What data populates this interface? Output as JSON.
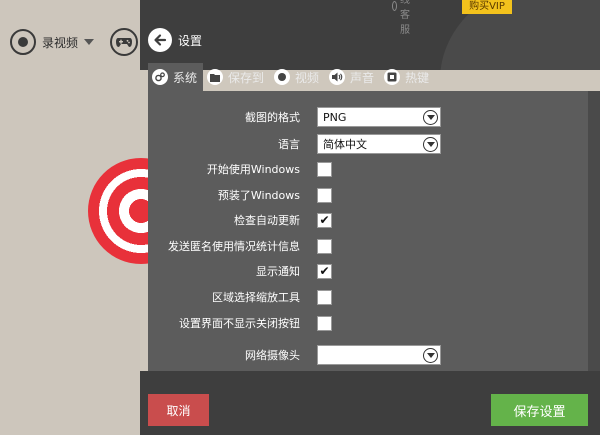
{
  "background_app": {
    "record_label": "录视频"
  },
  "header": {
    "service_label": "在线客服",
    "vip_label": "购买VIP",
    "title": "设置"
  },
  "tabs": [
    {
      "label": "系统",
      "icon": "gear-icon",
      "active": true
    },
    {
      "label": "保存到",
      "icon": "folder-icon",
      "active": false
    },
    {
      "label": "视频",
      "icon": "record-icon",
      "active": false
    },
    {
      "label": "声音",
      "icon": "speaker-icon",
      "active": false
    },
    {
      "label": "热键",
      "icon": "hotkey-icon",
      "active": false
    }
  ],
  "settings": {
    "screenshot_format": {
      "label": "截图的格式",
      "value": "PNG"
    },
    "language": {
      "label": "语言",
      "value": "简体中文"
    },
    "start_with_windows": {
      "label": "开始使用Windows",
      "checked": false
    },
    "preinstalled_windows": {
      "label": "预装了Windows",
      "checked": false
    },
    "auto_update": {
      "label": "检查自动更新",
      "checked": true
    },
    "send_anonymous_stats": {
      "label": "发送匿名使用情况统计信息",
      "checked": false
    },
    "show_notifications": {
      "label": "显示通知",
      "checked": true
    },
    "region_zoom_tool": {
      "label": "区域选择缩放工具",
      "checked": false
    },
    "hide_close_button": {
      "label": "设置界面不显示关闭按钮",
      "checked": false
    },
    "webcam": {
      "label": "网络摄像头",
      "value": ""
    }
  },
  "footer": {
    "cancel_label": "取消",
    "save_label": "保存设置"
  },
  "colors": {
    "cancel": "#c94d4d",
    "save": "#64b34a",
    "vip": "#f3c21c",
    "panel": "#5c5c5c",
    "header": "#3e3e3e"
  },
  "checkmark": "✔"
}
